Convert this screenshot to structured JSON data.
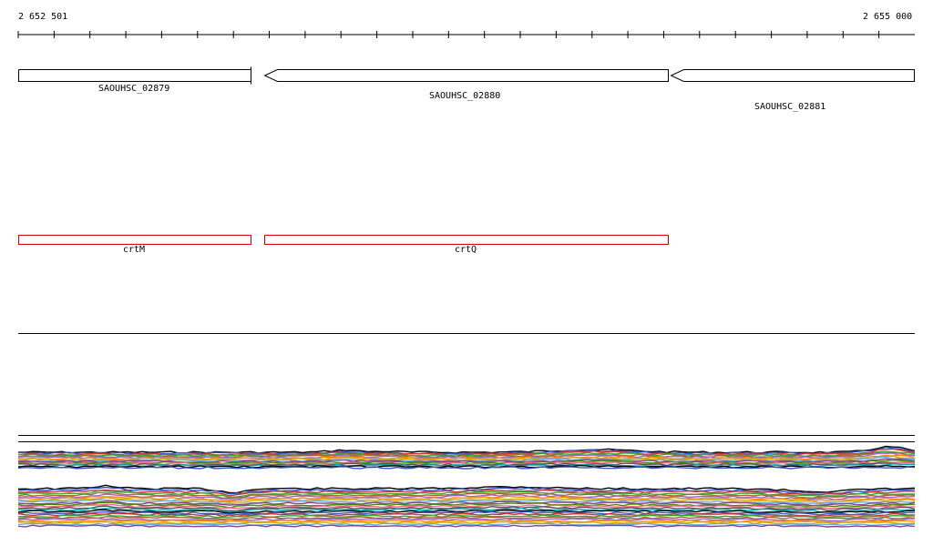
{
  "ruler": {
    "start_label": "2 652 501",
    "end_label": "2 655 000"
  },
  "genes": [
    {
      "label": "SAOUHSC_02879",
      "strand": "-",
      "color": "#000000"
    },
    {
      "label": "SAOUHSC_02880",
      "strand": "-",
      "color": "#000000"
    },
    {
      "label": "SAOUHSC_02881",
      "strand": "-",
      "color": "#000000"
    }
  ],
  "features": [
    {
      "label": "crtM",
      "color": "#cc0000"
    },
    {
      "label": "crtQ",
      "color": "#cc0000"
    }
  ],
  "track_colors": [
    "#000000",
    "#3355cc",
    "#cc3333",
    "#33aa33",
    "#aa6633",
    "#9966cc",
    "#ff8800",
    "#ccaa00",
    "#66aaee",
    "#884488",
    "#448800",
    "#ee6688",
    "#555555",
    "#00aaaa"
  ]
}
